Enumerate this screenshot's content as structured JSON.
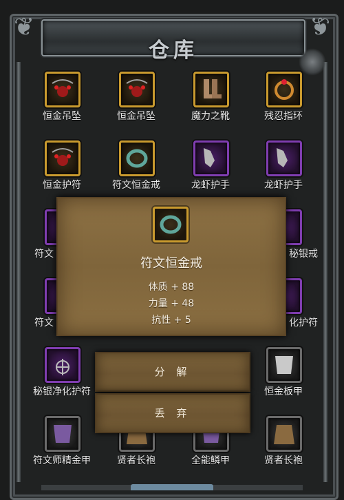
{
  "window": {
    "title": "仓库"
  },
  "grid": [
    {
      "label": "恒金吊坠",
      "rarity": "gold",
      "icon": "pendant-icon"
    },
    {
      "label": "恒金吊坠",
      "rarity": "gold",
      "icon": "pendant-icon"
    },
    {
      "label": "魔力之靴",
      "rarity": "gold",
      "icon": "boots-icon"
    },
    {
      "label": "残忍指环",
      "rarity": "gold",
      "icon": "ring-icon"
    },
    {
      "label": "恒金护符",
      "rarity": "gold",
      "icon": "amulet-icon"
    },
    {
      "label": "符文恒金戒",
      "rarity": "gold",
      "icon": "ring-icon"
    },
    {
      "label": "龙虾护手",
      "rarity": "purple",
      "icon": "gauntlet-icon"
    },
    {
      "label": "龙虾护手",
      "rarity": "purple",
      "icon": "gauntlet-icon"
    },
    {
      "label": "符文",
      "rarity": "purple",
      "icon": "ring-icon"
    },
    {
      "label": "",
      "rarity": "gold",
      "icon": "ring-icon"
    },
    {
      "label": "",
      "rarity": "gold",
      "icon": "ring-icon"
    },
    {
      "label": "秘银戒",
      "rarity": "purple",
      "icon": "ring-icon"
    },
    {
      "label": "符文",
      "rarity": "purple",
      "icon": "amulet-icon"
    },
    {
      "label": "",
      "rarity": "gold",
      "icon": "amulet-icon"
    },
    {
      "label": "",
      "rarity": "gold",
      "icon": "amulet-icon"
    },
    {
      "label": "化护符",
      "rarity": "purple",
      "icon": "amulet-icon"
    },
    {
      "label": "秘银净化护符",
      "rarity": "purple",
      "icon": "amulet-icon"
    },
    {
      "label": "",
      "rarity": "plain",
      "icon": "armor-icon"
    },
    {
      "label": "",
      "rarity": "plain",
      "icon": "armor-icon"
    },
    {
      "label": "恒金板甲",
      "rarity": "plain",
      "icon": "armor-icon"
    },
    {
      "label": "符文师精金甲",
      "rarity": "plain",
      "icon": "armor-icon"
    },
    {
      "label": "贤者长袍",
      "rarity": "plain",
      "icon": "robe-icon"
    },
    {
      "label": "全能鳞甲",
      "rarity": "plain",
      "icon": "armor-icon"
    },
    {
      "label": "贤者长袍",
      "rarity": "plain",
      "icon": "robe-icon"
    }
  ],
  "tooltip": {
    "item_name": "符文恒金戒",
    "stats": [
      "体质 + 88",
      "力量 + 48",
      "抗性 + 5"
    ]
  },
  "actions": {
    "decompose_label": "分 解",
    "discard_label": "丢 弃"
  },
  "colors": {
    "gold_frame": "#c99a2e",
    "purple_frame": "#7f3db0",
    "parchment": "#8d7144"
  }
}
